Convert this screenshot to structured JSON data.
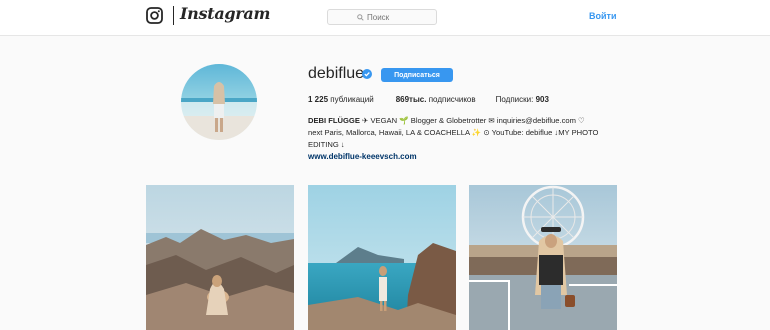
{
  "header": {
    "logo_text": "Instagram",
    "search_placeholder": "Поиск",
    "login_label": "Войти"
  },
  "profile": {
    "username": "debiflue",
    "follow_label": "Подписаться",
    "stats": {
      "posts_value": "1 225",
      "posts_label": "публикаций",
      "followers_value": "869тыс.",
      "followers_label": "подписчиков",
      "following_label": "Подписки:",
      "following_value": "903"
    },
    "bio": {
      "name": "DEBI FLÜGGE",
      "line1_rest": " ✈ VEGAN 🌱 Blogger & Globetrotter ✉ inquiries@debiflue.com ♡",
      "line2": "next Paris, Mallorca, Hawaii, LA & COACHELLA ✨ ⊙ YouTube: debiflue ↓MY PHOTO",
      "line3": "EDITING ↓",
      "link": "www.debiflue-keeevsch.com"
    }
  },
  "colors": {
    "accent": "#3897f0",
    "link": "#003569",
    "text": "#262626"
  },
  "icons": {
    "logo": "instagram-glyph-icon",
    "search": "search-icon",
    "verified": "verified-badge-icon"
  }
}
